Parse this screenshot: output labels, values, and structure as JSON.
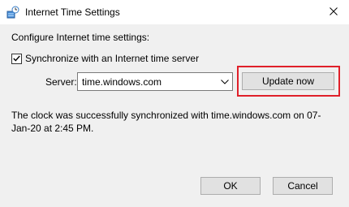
{
  "window": {
    "title": "Internet Time Settings",
    "icon": "internet-time-icon"
  },
  "settings": {
    "heading": "Configure Internet time settings:",
    "sync_label": "Synchronize with an Internet time server",
    "sync_checked": true,
    "server_label": "Server:",
    "server_value": "time.windows.com",
    "update_label": "Update now",
    "status": "The clock was successfully synchronized with time.windows.com on 07-Jan-20 at 2:45 PM."
  },
  "buttons": {
    "ok": "OK",
    "cancel": "Cancel"
  },
  "colors": {
    "highlight": "#e0202a",
    "button_face": "#e1e1e1",
    "dialog_bg": "#f0f0f0"
  }
}
